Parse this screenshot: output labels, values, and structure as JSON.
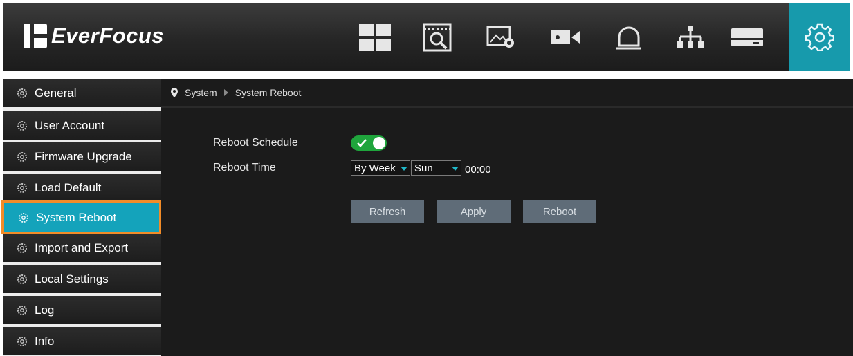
{
  "brand": {
    "name": "EverFocus"
  },
  "top_nav": [
    {
      "icon": "grid-layout-icon"
    },
    {
      "icon": "playback-search-icon"
    },
    {
      "icon": "image-settings-icon"
    },
    {
      "icon": "camera-icon"
    },
    {
      "icon": "alarm-bell-icon"
    },
    {
      "icon": "network-icon"
    },
    {
      "icon": "storage-hdd-icon"
    },
    {
      "icon": "settings-gear-icon",
      "active": true
    }
  ],
  "sidebar": {
    "items": [
      {
        "label": "General"
      },
      {
        "label": "User Account"
      },
      {
        "label": "Firmware Upgrade"
      },
      {
        "label": "Load Default"
      },
      {
        "label": "System Reboot",
        "active": true
      },
      {
        "label": "Import and Export"
      },
      {
        "label": "Local Settings"
      },
      {
        "label": "Log"
      },
      {
        "label": "Info"
      }
    ]
  },
  "breadcrumb": {
    "root": "System",
    "current": "System Reboot"
  },
  "form": {
    "reboot_schedule_label": "Reboot Schedule",
    "reboot_schedule_enabled": true,
    "reboot_time_label": "Reboot Time",
    "frequency_value": "By Week",
    "day_value": "Sun",
    "hour": "00",
    "minute": "00"
  },
  "buttons": {
    "refresh": "Refresh",
    "apply": "Apply",
    "reboot": "Reboot"
  },
  "colors": {
    "accent": "#179aac",
    "toggle_on": "#1fa53c",
    "highlight_border": "#f28c28",
    "button": "#5f6c78"
  }
}
